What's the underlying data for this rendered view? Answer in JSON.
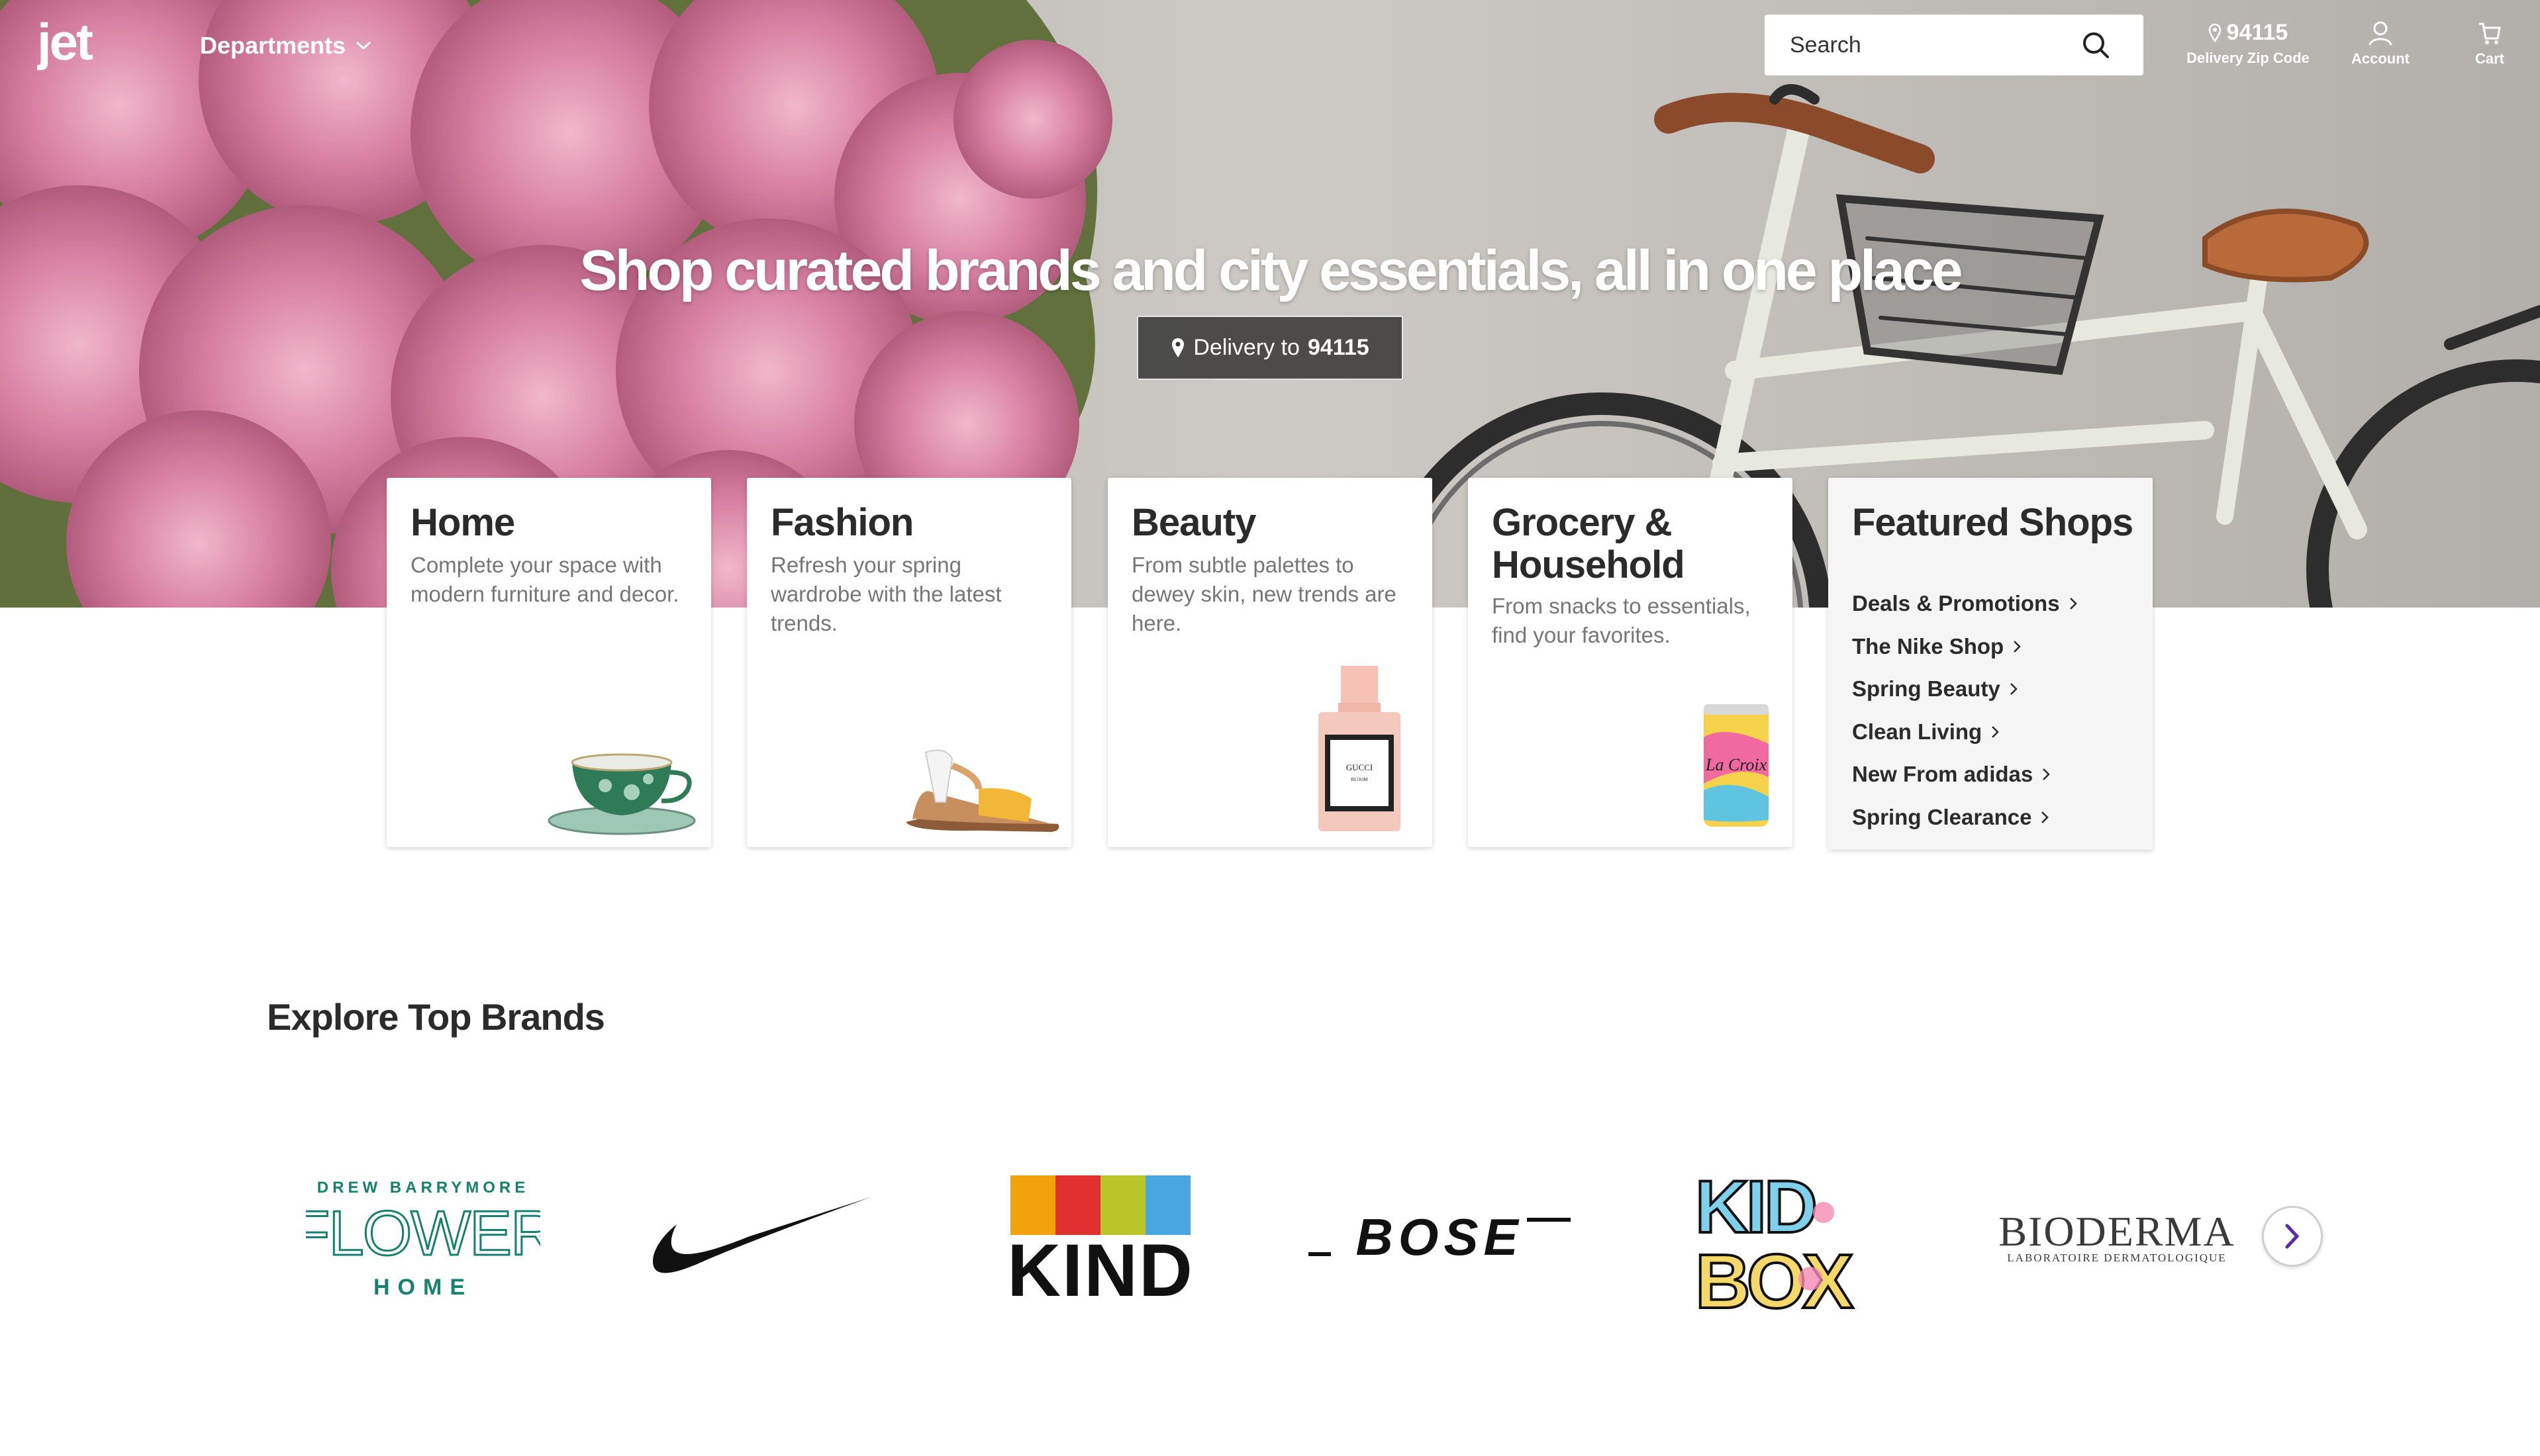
{
  "header": {
    "logo_text": "jet",
    "departments_label": "Departments",
    "search_placeholder": "Search",
    "zip_value": "94115",
    "zip_label": "Delivery Zip Code",
    "account_label": "Account",
    "cart_label": "Cart"
  },
  "hero": {
    "title": "Shop curated brands and city essentials, all in one place",
    "delivery_prefix": "Delivery to",
    "delivery_zip": "94115"
  },
  "cards": [
    {
      "title": "Home",
      "desc": "Complete your space with modern furniture and decor."
    },
    {
      "title": "Fashion",
      "desc": "Refresh your spring wardrobe with the latest trends."
    },
    {
      "title": "Beauty",
      "desc": "From subtle palettes to dewey skin, new trends are here."
    },
    {
      "title": "Grocery & Household",
      "desc": "From snacks to essentials, find your favorites."
    }
  ],
  "featured": {
    "title": "Featured Shops",
    "shops": [
      "Deals & Promotions",
      "The Nike Shop",
      "Spring Beauty",
      "Clean Living",
      "New From adidas",
      "Spring Clearance"
    ]
  },
  "brands": {
    "title": "Explore Top Brands",
    "flower_top": "DREW BARRYMORE",
    "flower_main": "FLOWER",
    "flower_bottom": "HOME",
    "kind": "KIND",
    "bose": "BOSE",
    "kidbox_top": "KID",
    "kidbox_bottom": "BOX",
    "bioderma_main": "BIODERMA",
    "bioderma_sub": "LABORATOIRE DERMATOLOGIQUE",
    "perfume_label_1": "GUCCI",
    "perfume_label_2": "BLOOM",
    "lacroix_text": "La Croix"
  },
  "colors": {
    "accent_purple": "#5b2ba8",
    "flower_green": "#17806f",
    "blossom_pink": "#d98aa8"
  }
}
